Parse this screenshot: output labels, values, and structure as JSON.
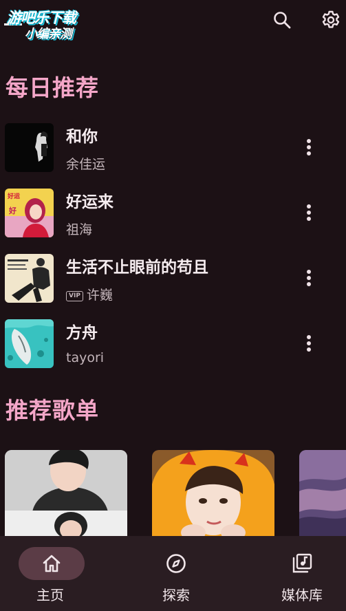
{
  "app": {
    "logo_line1": "游吧乐下载",
    "logo_line2": "小编亲测"
  },
  "header": {
    "icons": [
      "search-icon",
      "settings-gear-icon"
    ]
  },
  "daily": {
    "title": "每日推荐",
    "songs": [
      {
        "title": "和你",
        "artist": "余佳运",
        "vip": false
      },
      {
        "title": "好运来",
        "artist": "祖海",
        "vip": false
      },
      {
        "title": "生活不止眼前的苟且",
        "artist": "许巍",
        "vip": true,
        "badge": "VIP"
      },
      {
        "title": "方舟",
        "artist": "tayori",
        "vip": false
      }
    ]
  },
  "playlists": {
    "title": "推荐歌单",
    "count_visible": 3
  },
  "bottom_nav": {
    "items": [
      {
        "label": "主页",
        "icon": "home-icon",
        "active": true
      },
      {
        "label": "探索",
        "icon": "compass-icon",
        "active": false
      },
      {
        "label": "媒体库",
        "icon": "library-music-icon",
        "active": false
      }
    ]
  },
  "colors": {
    "background": "#1c1115",
    "accent": "#f4a6c8",
    "nav_background": "#2a1d22",
    "active_pill": "#5b3c46"
  }
}
